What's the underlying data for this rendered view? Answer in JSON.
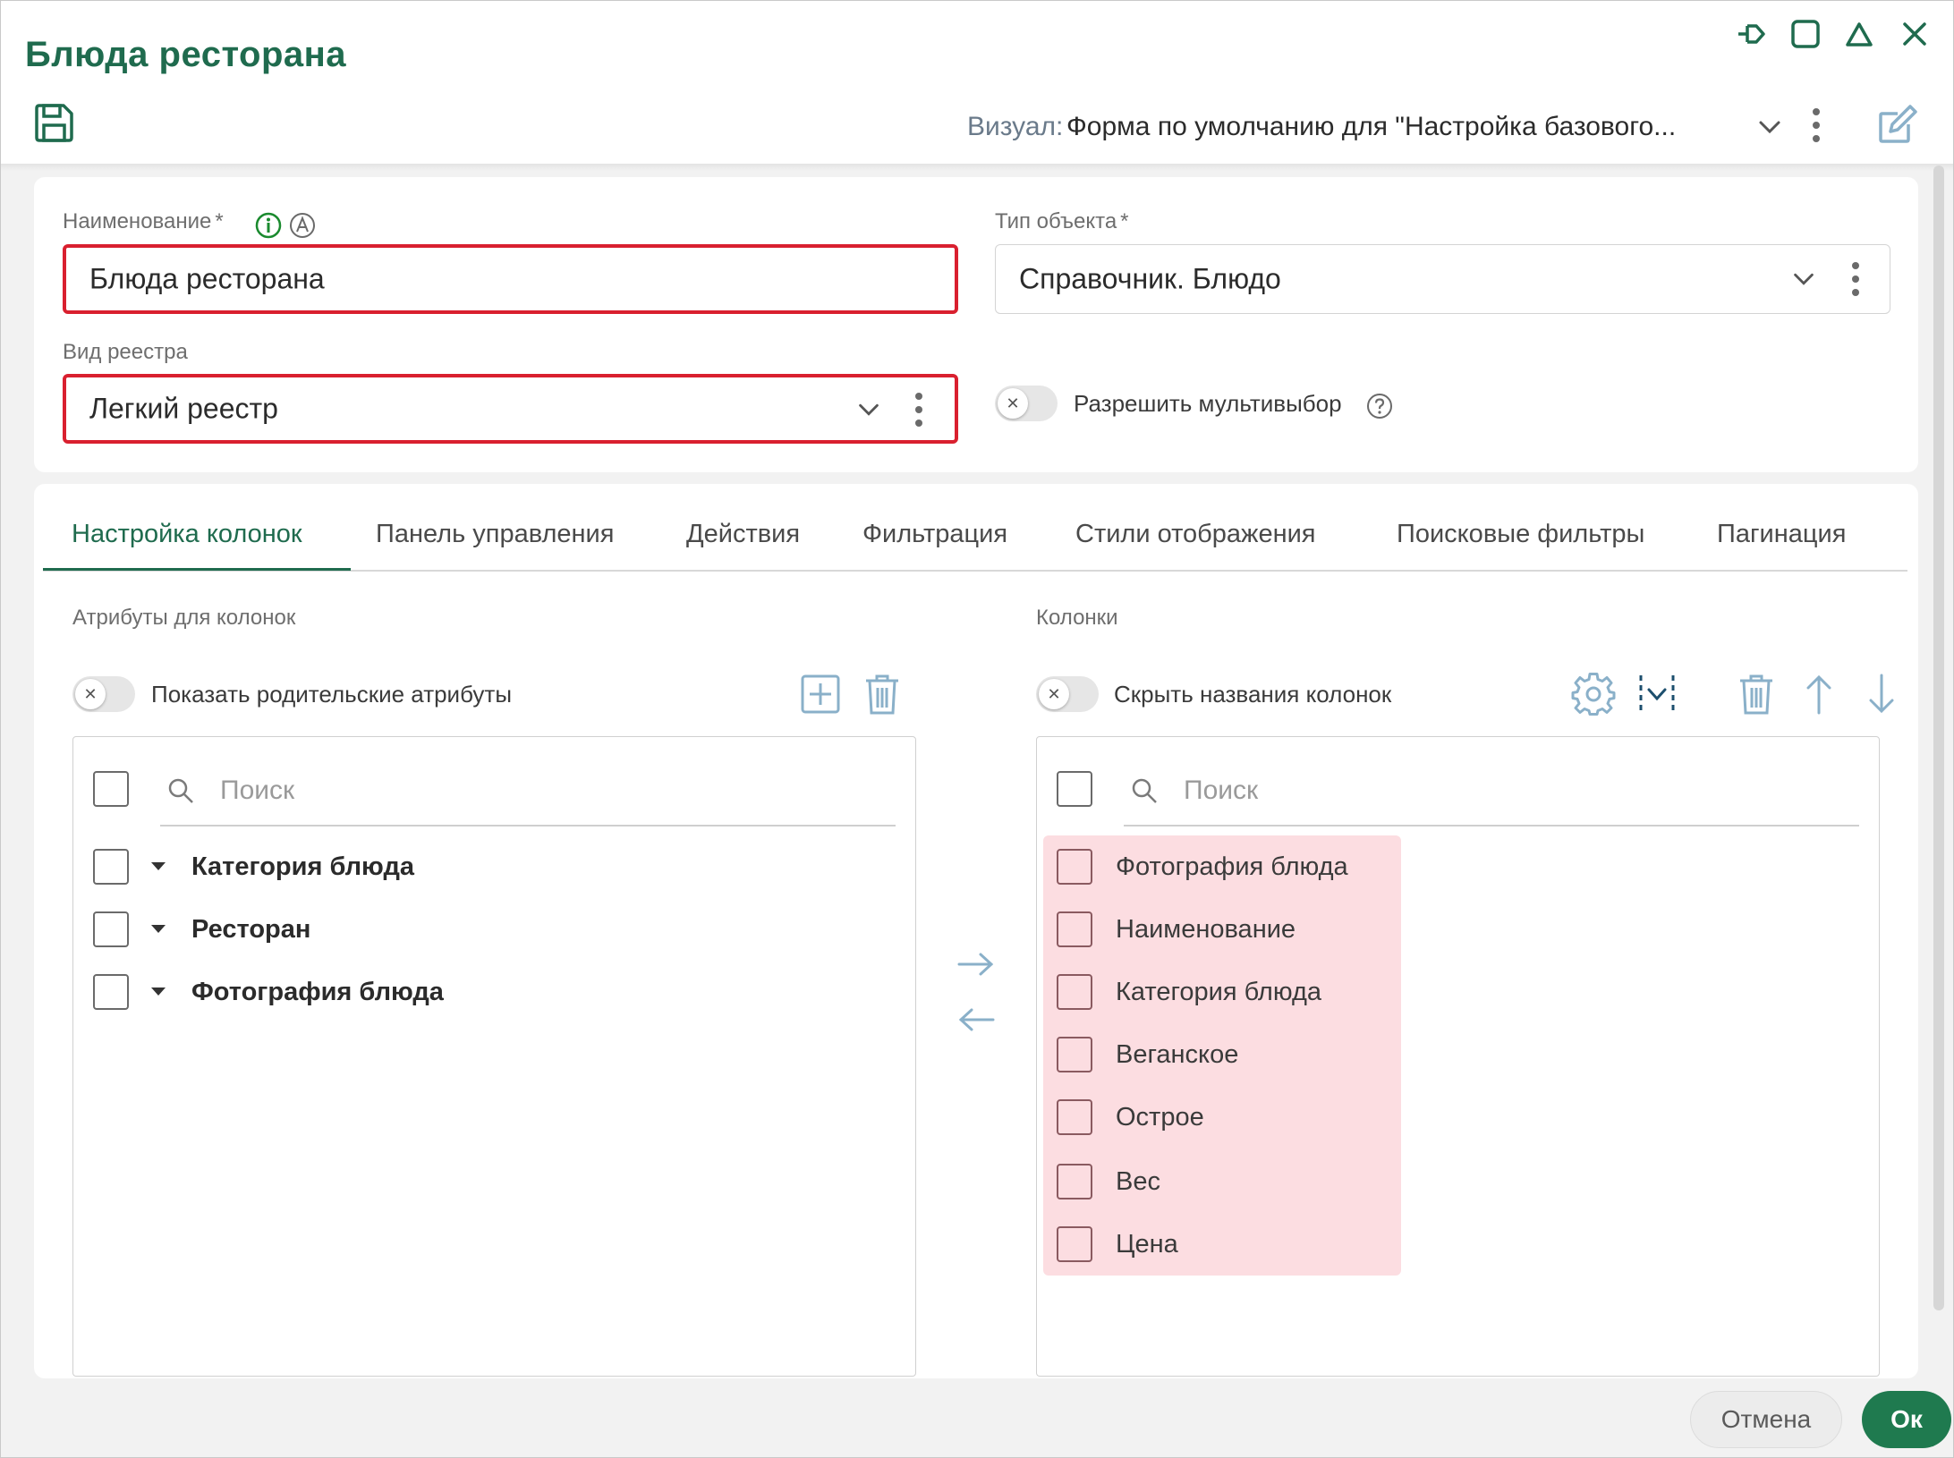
{
  "window": {
    "title": "Блюда ресторана",
    "controls": [
      "pin-icon",
      "maximize-icon",
      "collapse-icon",
      "close-icon"
    ]
  },
  "toolbar": {
    "visual_label": "Визуал:",
    "visual_value": "Форма по умолчанию для \"Настройка базового...",
    "icons": [
      "save-icon",
      "chevron-down-icon",
      "more-vertical-icon",
      "edit-icon"
    ]
  },
  "form": {
    "name_label": "Наименование",
    "name_required": "*",
    "name_value": "Блюда ресторана",
    "object_type_label": "Тип объекта",
    "object_type_required": "*",
    "object_type_value": "Справочник. Блюдо",
    "registry_label": "Вид реестра",
    "registry_value": "Легкий реестр",
    "multiselect_label": "Разрешить мультивыбор",
    "multiselect_on": false
  },
  "tabs": [
    {
      "label": "Настройка колонок",
      "active": true
    },
    {
      "label": "Панель управления",
      "active": false
    },
    {
      "label": "Действия",
      "active": false
    },
    {
      "label": "Фильтрация",
      "active": false
    },
    {
      "label": "Стили отображения",
      "active": false
    },
    {
      "label": "Поисковые фильтры",
      "active": false
    },
    {
      "label": "Пагинация",
      "active": false
    }
  ],
  "attributes": {
    "section_label": "Атрибуты для колонок",
    "toggle_label": "Показать родительские атрибуты",
    "toggle_on": false,
    "search_placeholder": "Поиск",
    "items": [
      "Категория блюда",
      "Ресторан",
      "Фотография блюда"
    ]
  },
  "columns": {
    "section_label": "Колонки",
    "toggle_label": "Скрыть названия колонок",
    "toggle_on": false,
    "search_placeholder": "Поиск",
    "items": [
      "Фотография блюда",
      "Наименование",
      "Категория блюда",
      "Веганское",
      "Острое",
      "Вес",
      "Цена"
    ]
  },
  "footer": {
    "cancel_label": "Отмена",
    "ok_label": "Ок"
  },
  "colors": {
    "brand": "#1f6b4e",
    "error": "#d9202f",
    "highlight": "#fcdde1",
    "ok_button": "#1f7a4f"
  }
}
